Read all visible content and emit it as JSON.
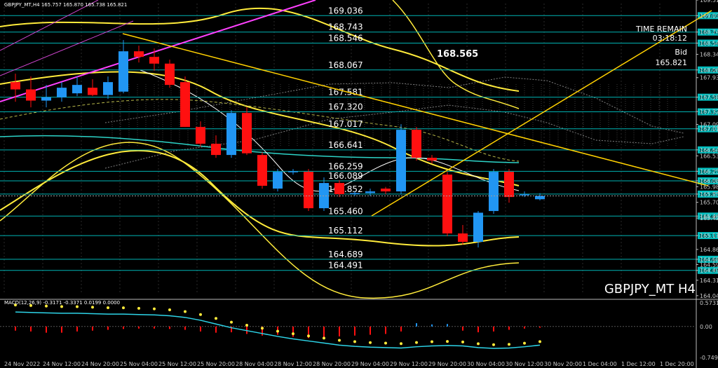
{
  "header_text": "GBPJPY_MT,H4  165.757 165.870 165.738 165.821",
  "symbol_label": "GBPJPY_MT H4",
  "info": {
    "time_remain_label": "TIME REMAIN",
    "time_remain": "03:18:12",
    "bid_label": "Bid",
    "bid": "165.821"
  },
  "price_marker": "168.565",
  "macd_label": "MACD(12,26,9) -0.3171 -0.3371 0.0199 0.0000",
  "chart_data": {
    "type": "candlestick",
    "price_axis": {
      "ylim": [
        164.0,
        169.315
      ],
      "tick_labels": [
        "169.315",
        "169.036",
        "168.743",
        "168.546",
        "168.345",
        "168.067",
        "167.930",
        "167.581",
        "167.325",
        "167.095",
        "167.017",
        "166.641",
        "166.535",
        "166.259",
        "166.089",
        "165.985",
        "165.852",
        "165.705",
        "165.460",
        "165.425",
        "165.112",
        "164.865",
        "164.689",
        "164.595",
        "164.491",
        "164.315",
        "164.040"
      ]
    },
    "levels": [
      169.036,
      168.743,
      168.546,
      168.067,
      167.581,
      167.32,
      167.017,
      166.641,
      166.259,
      166.089,
      165.852,
      165.46,
      165.112,
      164.689,
      164.491
    ],
    "level_labels": [
      "169.036",
      "168.743",
      "168.546",
      "168.067",
      "167.581",
      "167.320",
      "167.017",
      "166.641",
      "166.259",
      "166.089",
      "165.852",
      "165.460",
      "165.112",
      "164.689",
      "164.491"
    ],
    "time_labels": [
      "24 Nov 2022",
      "24 Nov 12:00",
      "24 Nov 20:00",
      "25 Nov 04:00",
      "25 Nov 12:00",
      "25 Nov 20:00",
      "28 Nov 04:00",
      "28 Nov 12:00",
      "28 Nov 20:00",
      "29 Nov 04:00",
      "29 Nov 12:00",
      "29 Nov 20:00",
      "30 Nov 04:00",
      "30 Nov 12:00",
      "30 Nov 20:00",
      "1 Dec 04:00",
      "1 Dec 12:00",
      "1 Dec 20:00"
    ],
    "candles": [
      {
        "o": 167.85,
        "h": 168.0,
        "l": 167.5,
        "c": 167.72
      },
      {
        "o": 167.72,
        "h": 167.95,
        "l": 167.4,
        "c": 167.52
      },
      {
        "o": 167.52,
        "h": 167.8,
        "l": 167.4,
        "c": 167.58
      },
      {
        "o": 167.58,
        "h": 167.85,
        "l": 167.5,
        "c": 167.75
      },
      {
        "o": 167.65,
        "h": 167.95,
        "l": 167.6,
        "c": 167.8
      },
      {
        "o": 167.75,
        "h": 167.9,
        "l": 167.6,
        "c": 167.62
      },
      {
        "o": 167.62,
        "h": 167.95,
        "l": 167.55,
        "c": 167.85
      },
      {
        "o": 167.68,
        "h": 168.6,
        "l": 167.65,
        "c": 168.4
      },
      {
        "o": 168.4,
        "h": 168.5,
        "l": 168.2,
        "c": 168.3
      },
      {
        "o": 168.3,
        "h": 168.45,
        "l": 168.05,
        "c": 168.18
      },
      {
        "o": 168.18,
        "h": 168.25,
        "l": 167.75,
        "c": 167.8
      },
      {
        "o": 167.85,
        "h": 167.95,
        "l": 167.05,
        "c": 167.05
      },
      {
        "o": 167.05,
        "h": 167.15,
        "l": 166.7,
        "c": 166.75
      },
      {
        "o": 166.75,
        "h": 166.9,
        "l": 166.5,
        "c": 166.55
      },
      {
        "o": 166.55,
        "h": 167.35,
        "l": 166.5,
        "c": 167.3
      },
      {
        "o": 167.3,
        "h": 167.4,
        "l": 166.55,
        "c": 166.58
      },
      {
        "o": 166.55,
        "h": 166.6,
        "l": 165.95,
        "c": 166.0
      },
      {
        "o": 165.95,
        "h": 166.3,
        "l": 165.9,
        "c": 166.25
      },
      {
        "o": 166.25,
        "h": 166.3,
        "l": 166.2,
        "c": 166.26
      },
      {
        "o": 166.25,
        "h": 166.3,
        "l": 165.55,
        "c": 165.6
      },
      {
        "o": 165.6,
        "h": 166.15,
        "l": 165.55,
        "c": 166.05
      },
      {
        "o": 166.05,
        "h": 166.1,
        "l": 165.8,
        "c": 165.85
      },
      {
        "o": 165.85,
        "h": 165.9,
        "l": 165.82,
        "c": 165.87
      },
      {
        "o": 165.87,
        "h": 165.95,
        "l": 165.82,
        "c": 165.9
      },
      {
        "o": 165.95,
        "h": 165.98,
        "l": 165.85,
        "c": 165.9
      },
      {
        "o": 165.9,
        "h": 167.1,
        "l": 165.85,
        "c": 167.0
      },
      {
        "o": 167.0,
        "h": 167.05,
        "l": 166.45,
        "c": 166.5
      },
      {
        "o": 166.5,
        "h": 166.55,
        "l": 166.4,
        "c": 166.45
      },
      {
        "o": 166.2,
        "h": 166.25,
        "l": 165.1,
        "c": 165.15
      },
      {
        "o": 165.15,
        "h": 165.3,
        "l": 164.95,
        "c": 165.0
      },
      {
        "o": 165.0,
        "h": 165.55,
        "l": 164.9,
        "c": 165.52
      },
      {
        "o": 165.55,
        "h": 166.3,
        "l": 165.5,
        "c": 166.25
      },
      {
        "o": 166.25,
        "h": 166.3,
        "l": 165.7,
        "c": 165.8
      },
      {
        "o": 165.85,
        "h": 165.9,
        "l": 165.8,
        "c": 165.85
      },
      {
        "o": 165.76,
        "h": 165.87,
        "l": 165.74,
        "c": 165.82
      }
    ],
    "macd_axis": {
      "tick_labels": [
        "0.5731",
        "0.00",
        "-0.7497"
      ],
      "ylim": [
        -0.7497,
        0.5731
      ]
    },
    "macd_histogram": [
      -0.1,
      -0.12,
      -0.15,
      -0.15,
      -0.12,
      -0.1,
      -0.08,
      -0.06,
      -0.05,
      -0.05,
      -0.06,
      -0.08,
      -0.12,
      -0.15,
      -0.14,
      -0.18,
      -0.22,
      -0.2,
      -0.25,
      -0.28,
      -0.26,
      -0.24,
      -0.22,
      -0.2,
      -0.18,
      -0.12,
      0.08,
      0.05,
      0.06,
      -0.1,
      -0.14,
      -0.12,
      -0.08,
      -0.05,
      -0.03
    ],
    "macd_signal": [
      0.35,
      0.34,
      0.33,
      0.32,
      0.32,
      0.31,
      0.3,
      0.3,
      0.29,
      0.28,
      0.26,
      0.22,
      0.15,
      0.06,
      -0.03,
      -0.1,
      -0.17,
      -0.24,
      -0.3,
      -0.35,
      -0.4,
      -0.45,
      -0.48,
      -0.5,
      -0.51,
      -0.52,
      -0.49,
      -0.47,
      -0.46,
      -0.47,
      -0.51,
      -0.53,
      -0.52,
      -0.49,
      -0.45
    ]
  }
}
